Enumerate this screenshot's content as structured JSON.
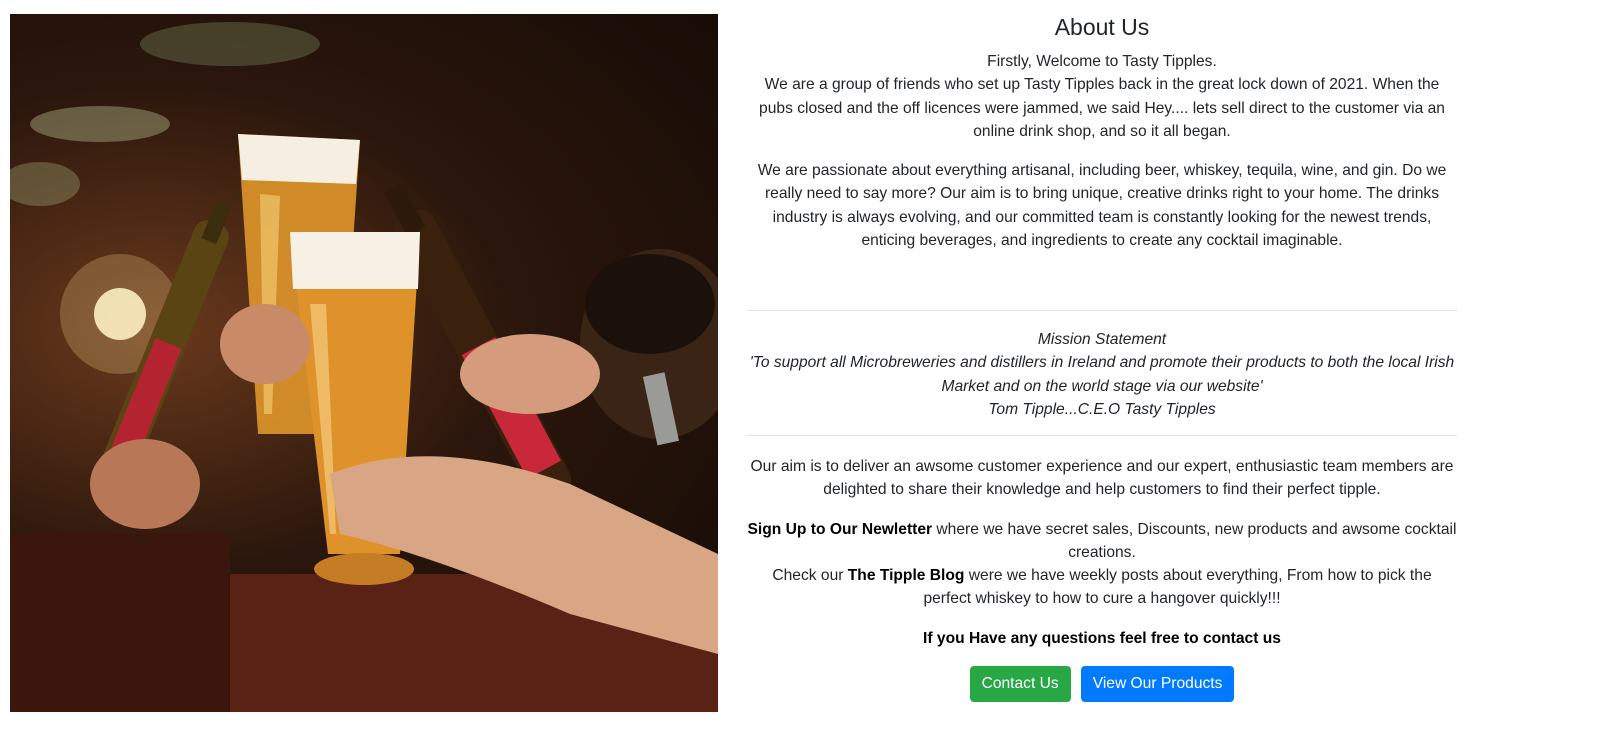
{
  "about": {
    "title": "About Us",
    "welcome": "Firstly, Welcome to Tasty Tipples.",
    "story": "We are a group of friends who set up Tasty Tipples back in the great lock down of 2021. When the pubs closed and the off licences were jammed, we said Hey.... lets sell direct to the customer via an online drink shop, and so it all began.",
    "passion": "We are passionate about everything artisanal, including beer, whiskey, tequila, wine, and gin. Do we really need to say more? Our aim is to bring unique, creative drinks right to your home. The drinks industry is always evolving, and our committed team is constantly looking for the newest trends, enticing beverages, and ingredients to create any cocktail imaginable."
  },
  "mission": {
    "heading": "Mission Statement",
    "quote": "'To support all Microbreweries and distillers in Ireland and promote their products to both the local Irish Market and on the world stage via our website'",
    "author": "Tom Tipple...C.E.O Tasty Tipples"
  },
  "aim": {
    "text": "Our aim is to deliver an awsome customer experience and our expert, enthusiastic team members are delighted to share their knowledge and help customers to find their perfect tipple."
  },
  "newsletter": {
    "link_label": "Sign Up to Our Newletter",
    "text": " where we have secret sales, Discounts, new products and awsome cocktail creations."
  },
  "blog": {
    "prefix": "Check our ",
    "link_label": "The Tipple Blog",
    "text": " were we have weekly posts about everything, From how to pick the perfect whiskey to how to cure a hangover quickly!!!"
  },
  "contact_prompt": "If you Have any questions feel free to contact us",
  "buttons": {
    "contact": "Contact Us",
    "products": "View Our Products"
  },
  "colors": {
    "contact_button": "#28a745",
    "products_button": "#007bff"
  }
}
